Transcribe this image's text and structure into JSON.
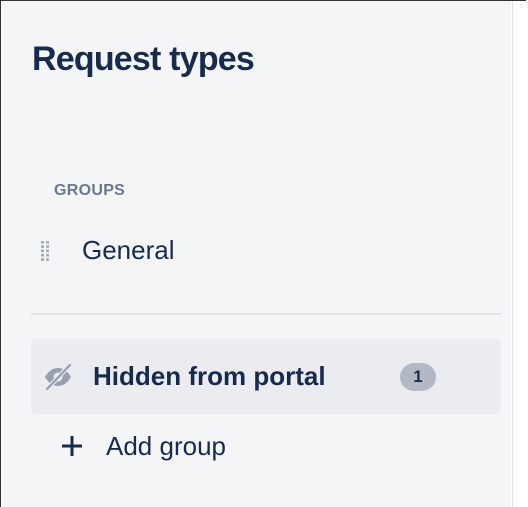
{
  "sidebar": {
    "title": "Request types",
    "groups_heading": "GROUPS",
    "groups": [
      {
        "label": "General",
        "icon": "drag-handle-icon"
      }
    ],
    "hidden": {
      "label": "Hidden from portal",
      "icon": "eye-slash-icon",
      "count": "1"
    },
    "add_group": {
      "label": "Add group",
      "icon": "plus-icon"
    }
  },
  "colors": {
    "text_primary": "#172b4d",
    "text_subtle": "#6b778c",
    "sidebar_bg": "#f4f5f7",
    "selected_bg": "#ebecf0",
    "badge_bg": "#b3b9c4",
    "divider": "#dfe1e6"
  }
}
